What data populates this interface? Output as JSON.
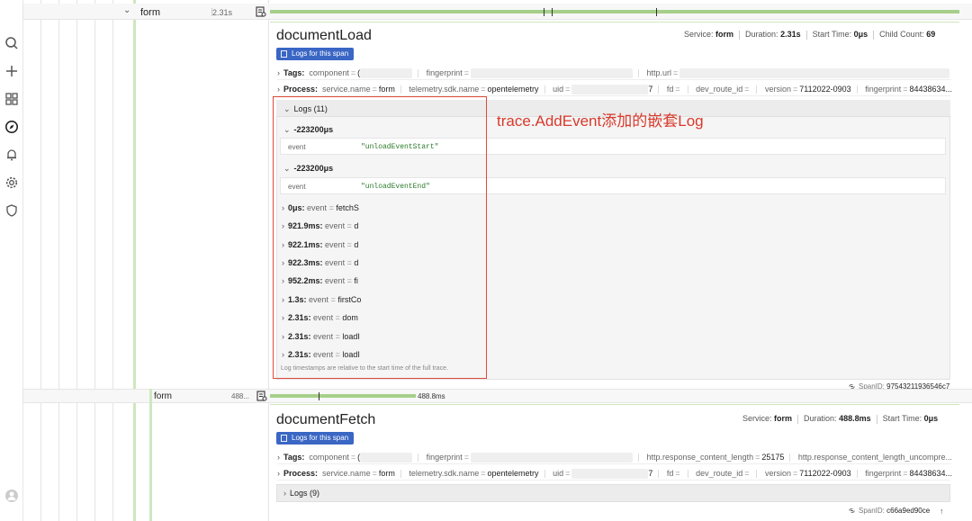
{
  "sidebar": {
    "icons": [
      "search-icon",
      "plus-icon",
      "dashboard-icon",
      "compass-icon",
      "bell-icon",
      "gear-icon",
      "shield-icon",
      "avatar-icon"
    ]
  },
  "span1": {
    "name": "form",
    "duration": "2.31s",
    "title": "documentLoad",
    "logs_button": "Logs for this span",
    "meta": {
      "service_label": "Service:",
      "service": "form",
      "duration_label": "Duration:",
      "duration": "2.31s",
      "start_label": "Start Time:",
      "start": "0μs",
      "child_label": "Child Count:",
      "child": "69"
    },
    "tags": {
      "label": "Tags:",
      "items": [
        {
          "k": "component",
          "v": "("
        },
        {
          "k": "fingerprint",
          "v": ""
        },
        {
          "k": "http.url",
          "v": ""
        }
      ]
    },
    "process": {
      "label": "Process:",
      "items": [
        {
          "k": "service.name",
          "v": "form"
        },
        {
          "k": "telemetry.sdk.name",
          "v": "opentelemetry"
        },
        {
          "k": "uid",
          "v": "7"
        },
        {
          "k": "fd",
          "v": ""
        },
        {
          "k": "dev_route_id",
          "v": ""
        },
        {
          "k": "version",
          "v": "7112022-0903"
        },
        {
          "k": "fingerprint",
          "v": "84438634..."
        }
      ]
    },
    "logs": {
      "header": "Logs (11)",
      "groups": [
        {
          "time": "-223200μs",
          "key": "event",
          "value": "\"unloadEventStart\""
        },
        {
          "time": "-223200μs",
          "key": "event",
          "value": "\"unloadEventEnd\""
        }
      ],
      "rows": [
        {
          "t": "0μs:",
          "k": "event",
          "v": "fetchS"
        },
        {
          "t": "921.9ms:",
          "k": "event",
          "v": "d"
        },
        {
          "t": "922.1ms:",
          "k": "event",
          "v": "d"
        },
        {
          "t": "922.3ms:",
          "k": "event",
          "v": "d"
        },
        {
          "t": "952.2ms:",
          "k": "event",
          "v": "fi"
        },
        {
          "t": "1.3s:",
          "k": "event",
          "v": "firstCo"
        },
        {
          "t": "2.31s:",
          "k": "event",
          "v": "dom"
        },
        {
          "t": "2.31s:",
          "k": "event",
          "v": "loadI"
        },
        {
          "t": "2.31s:",
          "k": "event",
          "v": "loadI"
        }
      ],
      "footnote": "Log timestamps are relative to the start time of the full trace."
    },
    "span_id_label": "SpanID:",
    "span_id": "97543211936546c7"
  },
  "annotation": "trace.AddEvent添加的嵌套Log",
  "span2": {
    "name": "form",
    "duration_short": "488...",
    "bar_label": "488.8ms",
    "title": "documentFetch",
    "logs_button": "Logs for this span",
    "meta": {
      "service_label": "Service:",
      "service": "form",
      "duration_label": "Duration:",
      "duration": "488.8ms",
      "start_label": "Start Time:",
      "start": "0μs"
    },
    "tags": {
      "label": "Tags:",
      "items": [
        {
          "k": "component",
          "v": "("
        },
        {
          "k": "fingerprint",
          "v": ""
        },
        {
          "k": "http.response_content_length",
          "v": "25175"
        },
        {
          "k": "http.response_content_length_uncompre...",
          "v": ""
        }
      ]
    },
    "process": {
      "label": "Process:",
      "items": [
        {
          "k": "service.name",
          "v": "form"
        },
        {
          "k": "telemetry.sdk.name",
          "v": "opentelemetry"
        },
        {
          "k": "uid",
          "v": "7"
        },
        {
          "k": "fd",
          "v": ""
        },
        {
          "k": "dev_route_id",
          "v": ""
        },
        {
          "k": "version",
          "v": "7112022-0903"
        },
        {
          "k": "fingerprint",
          "v": "84438634..."
        }
      ]
    },
    "logs_header": "Logs (9)",
    "span_id_label": "SpanID:",
    "span_id": "c66a9ed90ce"
  },
  "colors": {
    "accent": "#3a66c4",
    "bar": "#a6cf8a",
    "annotation": "#e04b3a"
  }
}
